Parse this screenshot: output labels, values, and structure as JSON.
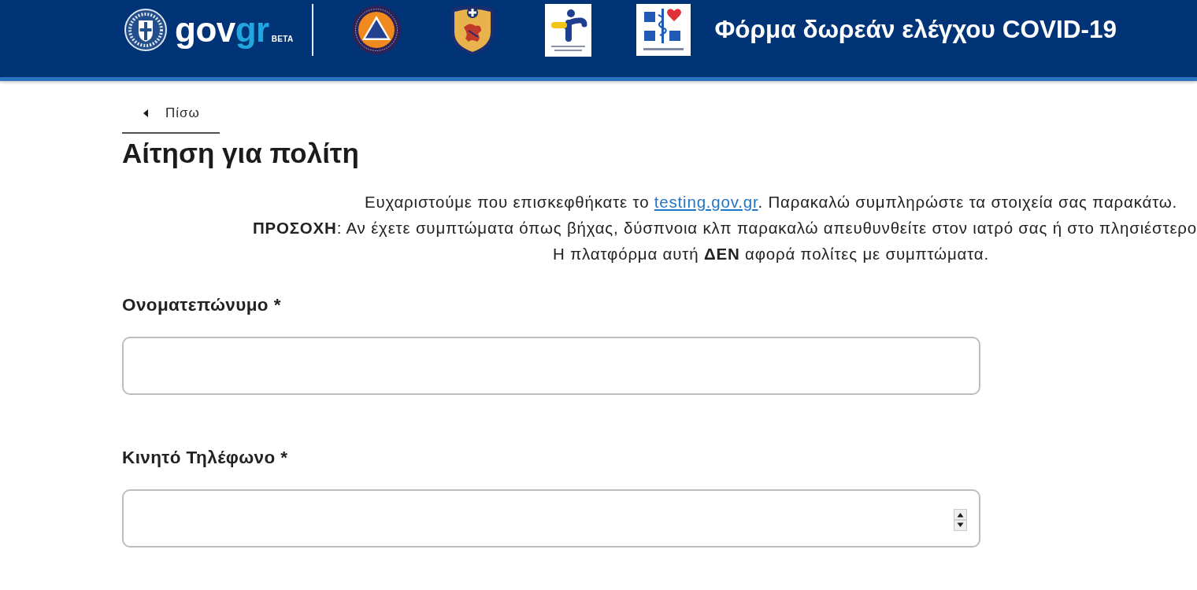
{
  "header": {
    "brand": {
      "name_parts": [
        "gov",
        "gr"
      ],
      "tag": "BETA"
    },
    "title": "Φόρμα δωρεάν ελέγχου COVID-19"
  },
  "back_link": {
    "label": "Πίσω"
  },
  "heading": "Αίτηση για πολίτη",
  "intro": [
    {
      "kind": "link_line",
      "text_before": "Ευχαριστούμε που επισκεφθήκατε το ",
      "link": "testing.gov.gr",
      "text_after": ". Παρακαλώ συμπληρώστε τα στοιχεία σας παρακάτω."
    },
    {
      "kind": "wide_line",
      "text": "**ΠΡΟΣΟΧΗ**: Αν έχετε συμπτώματα όπως βήχας, δύσπνοια κλπ παρακαλώ απευθυνθείτε στον ιατρό σας ή στο πλησιέστερο"
    },
    {
      "kind": "line",
      "text": "Η πλατφόρμα αυτή **ΔΕΝ** αφορά πολίτες με συμπτώματα."
    }
  ],
  "fields": [
    {
      "label": "Ονοματεπώνυμο *",
      "kind": "text"
    },
    {
      "label": "Κινητό Τηλέφωνο *",
      "kind": "number"
    }
  ]
}
